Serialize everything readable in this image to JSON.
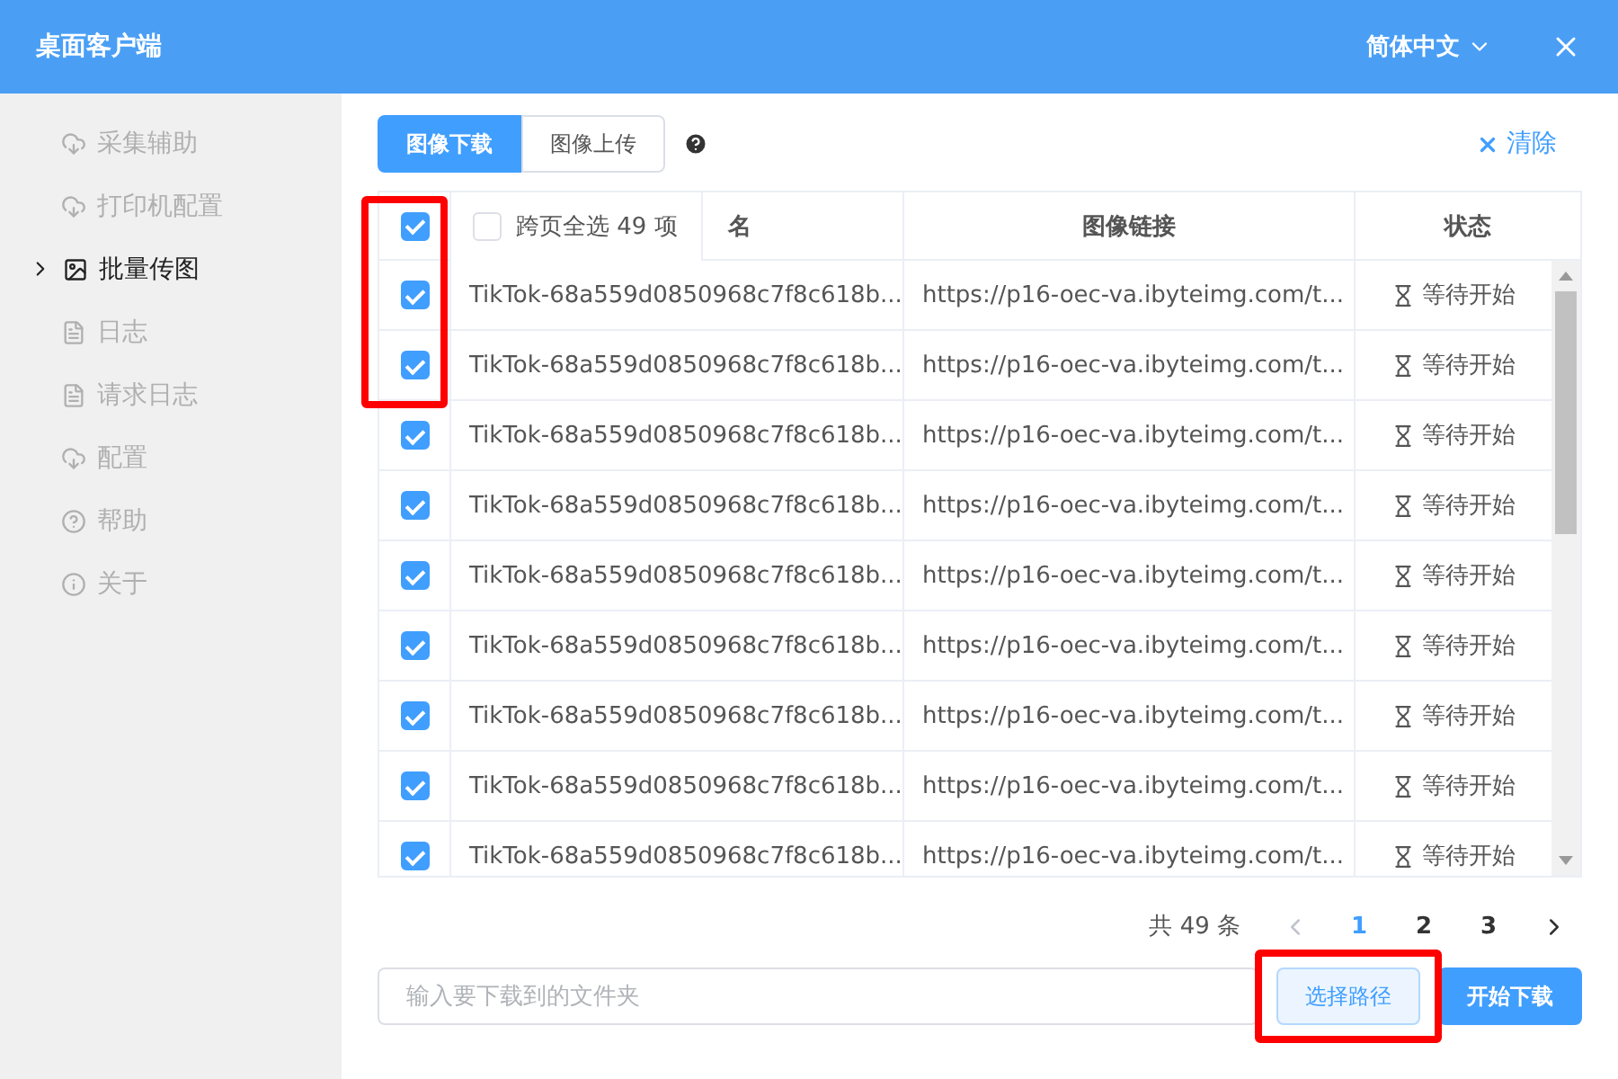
{
  "window": {
    "title": "桌面客户端",
    "language": "简体中文"
  },
  "sidebar": {
    "items": [
      {
        "label": "采集辅助",
        "kind": "cloud",
        "selected": false
      },
      {
        "label": "打印机配置",
        "kind": "cloud",
        "selected": false
      },
      {
        "label": "批量传图",
        "kind": "image",
        "selected": true
      },
      {
        "label": "日志",
        "kind": "file",
        "selected": false
      },
      {
        "label": "请求日志",
        "kind": "file",
        "selected": false
      },
      {
        "label": "配置",
        "kind": "cloud",
        "selected": false
      },
      {
        "label": "帮助",
        "kind": "help",
        "selected": false
      },
      {
        "label": "关于",
        "kind": "info",
        "selected": false
      }
    ]
  },
  "tabs": [
    {
      "label": "图像下载",
      "selected": true
    },
    {
      "label": "图像上传",
      "selected": false
    }
  ],
  "clear_button": "清除",
  "table": {
    "header_checked": true,
    "select_all_pages": {
      "label": "跨页全选 49 项",
      "checked": false
    },
    "columns": [
      "名",
      "图像链接",
      "状态"
    ],
    "rows": [
      {
        "checked": true,
        "name": "TikTok-68a559d0850968c7f8c618b...",
        "link": "https://p16-oec-va.ibyteimg.com/t...",
        "status": "等待开始"
      },
      {
        "checked": true,
        "name": "TikTok-68a559d0850968c7f8c618b...",
        "link": "https://p16-oec-va.ibyteimg.com/t...",
        "status": "等待开始"
      },
      {
        "checked": true,
        "name": "TikTok-68a559d0850968c7f8c618b...",
        "link": "https://p16-oec-va.ibyteimg.com/t...",
        "status": "等待开始"
      },
      {
        "checked": true,
        "name": "TikTok-68a559d0850968c7f8c618b...",
        "link": "https://p16-oec-va.ibyteimg.com/t...",
        "status": "等待开始"
      },
      {
        "checked": true,
        "name": "TikTok-68a559d0850968c7f8c618b...",
        "link": "https://p16-oec-va.ibyteimg.com/t...",
        "status": "等待开始"
      },
      {
        "checked": true,
        "name": "TikTok-68a559d0850968c7f8c618b...",
        "link": "https://p16-oec-va.ibyteimg.com/t...",
        "status": "等待开始"
      },
      {
        "checked": true,
        "name": "TikTok-68a559d0850968c7f8c618b...",
        "link": "https://p16-oec-va.ibyteimg.com/t...",
        "status": "等待开始"
      },
      {
        "checked": true,
        "name": "TikTok-68a559d0850968c7f8c618b...",
        "link": "https://p16-oec-va.ibyteimg.com/t...",
        "status": "等待开始"
      },
      {
        "checked": true,
        "name": "TikTok-68a559d0850968c7f8c618b...",
        "link": "https://p16-oec-va.ibyteimg.com/t...",
        "status": "等待开始"
      }
    ]
  },
  "pagination": {
    "total": "共 49 条",
    "pages": [
      {
        "label": "1",
        "selected": true
      },
      {
        "label": "2",
        "selected": false
      },
      {
        "label": "3",
        "selected": false
      }
    ]
  },
  "folder_field": {
    "placeholder": "输入要下载到的文件夹"
  },
  "choose_path_button": "选择路径",
  "start_button": "开始下载"
}
